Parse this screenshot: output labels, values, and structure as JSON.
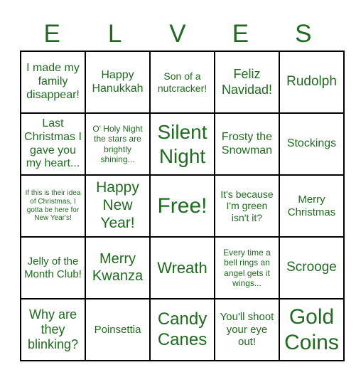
{
  "header": [
    "E",
    "L",
    "V",
    "E",
    "S"
  ],
  "accent_color": "#1f6b1f",
  "grid": [
    [
      {
        "text": "I made my family disappear!",
        "size": 16
      },
      {
        "text": "Happy Hanukkah",
        "size": 16
      },
      {
        "text": "Son of a nutcracker!",
        "size": 14
      },
      {
        "text": "Feliz Navidad!",
        "size": 18
      },
      {
        "text": "Rudolph",
        "size": 19
      }
    ],
    [
      {
        "text": "Last Christmas I gave you my heart...",
        "size": 16
      },
      {
        "text": "O' Holy Night the stars are brightly shining...",
        "size": 12
      },
      {
        "text": "Silent Night",
        "size": 28
      },
      {
        "text": "Frosty the Snowman",
        "size": 16
      },
      {
        "text": "Stockings",
        "size": 16
      }
    ],
    [
      {
        "text": "If this is their idea of Christmas, I gotta be here for New Year's!",
        "size": 10
      },
      {
        "text": "Happy New Year!",
        "size": 21
      },
      {
        "text": "Free!",
        "size": 30
      },
      {
        "text": "It's because I'm green isn't it?",
        "size": 14
      },
      {
        "text": "Merry Christmas",
        "size": 15
      }
    ],
    [
      {
        "text": "Jelly of the Month Club!",
        "size": 15
      },
      {
        "text": "Merry Kwanza",
        "size": 20
      },
      {
        "text": "Wreath",
        "size": 22
      },
      {
        "text": "Every time a bell rings an angel gets it wings...",
        "size": 12
      },
      {
        "text": "Scrooge",
        "size": 19
      }
    ],
    [
      {
        "text": "Why are they blinking?",
        "size": 18
      },
      {
        "text": "Poinsettia",
        "size": 15
      },
      {
        "text": "Candy Canes",
        "size": 24
      },
      {
        "text": "You'll shoot your eye out!",
        "size": 15
      },
      {
        "text": "Gold Coins",
        "size": 30
      }
    ]
  ]
}
